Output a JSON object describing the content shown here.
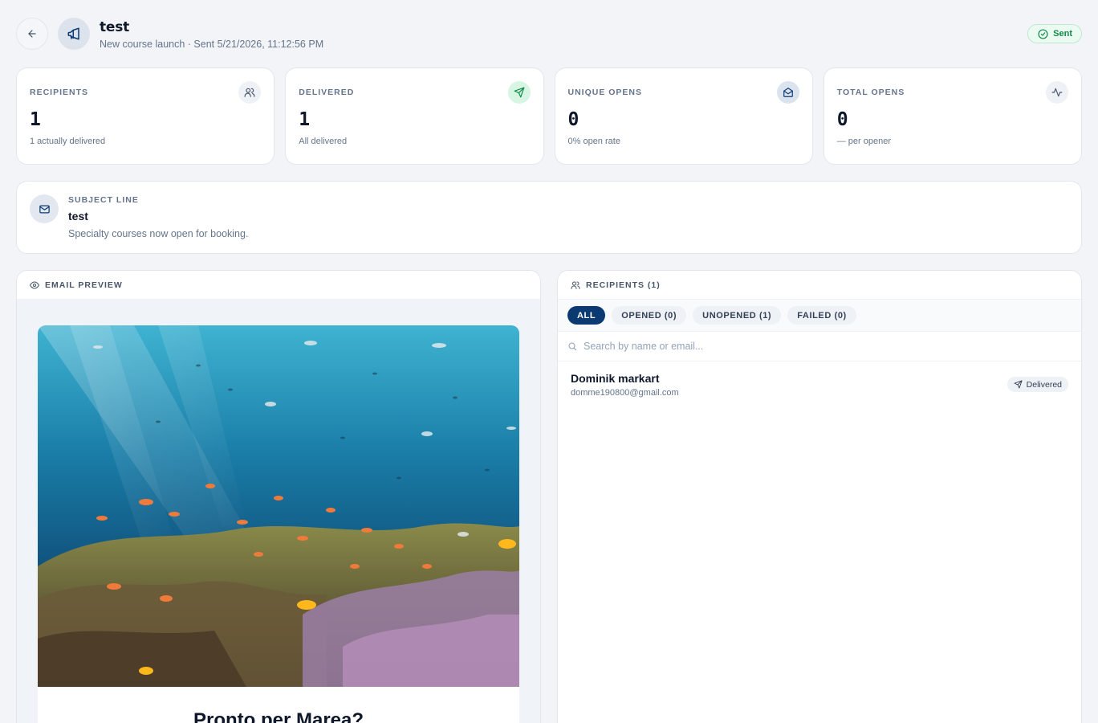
{
  "header": {
    "title": "test",
    "subtitle": "New course launch · Sent 5/21/2026, 11:12:56 PM",
    "status": "Sent",
    "back_icon": "arrow-left-icon",
    "campaign_icon": "megaphone-icon"
  },
  "stats": [
    {
      "label": "RECIPIENTS",
      "value": "1",
      "hint": "1 actually delivered",
      "icon": "users-icon"
    },
    {
      "label": "DELIVERED",
      "value": "1",
      "hint": "All delivered",
      "icon": "send-icon"
    },
    {
      "label": "UNIQUE OPENS",
      "value": "0",
      "hint": "0% open rate",
      "icon": "mail-open-icon"
    },
    {
      "label": "TOTAL OPENS",
      "value": "0",
      "hint": "— per opener",
      "icon": "activity-icon"
    }
  ],
  "subject": {
    "label": "SUBJECT LINE",
    "title": "test",
    "preheader": "Specialty courses now open for booking."
  },
  "preview": {
    "header": "EMAIL PREVIEW",
    "headline": "Pronto per Marea?"
  },
  "recipients_panel": {
    "header": "RECIPIENTS (1)",
    "filters": [
      "ALL",
      "OPENED (0)",
      "UNOPENED (1)",
      "FAILED (0)"
    ],
    "active_filter": "ALL",
    "search_placeholder": "Search by name or email...",
    "rows": [
      {
        "name": "Dominik markart",
        "email": "domme190800@gmail.com",
        "status": "Delivered"
      }
    ]
  },
  "colors": {
    "accent": "#0b3a73",
    "success": "#0f8a4a",
    "background": "#f2f4f7"
  }
}
